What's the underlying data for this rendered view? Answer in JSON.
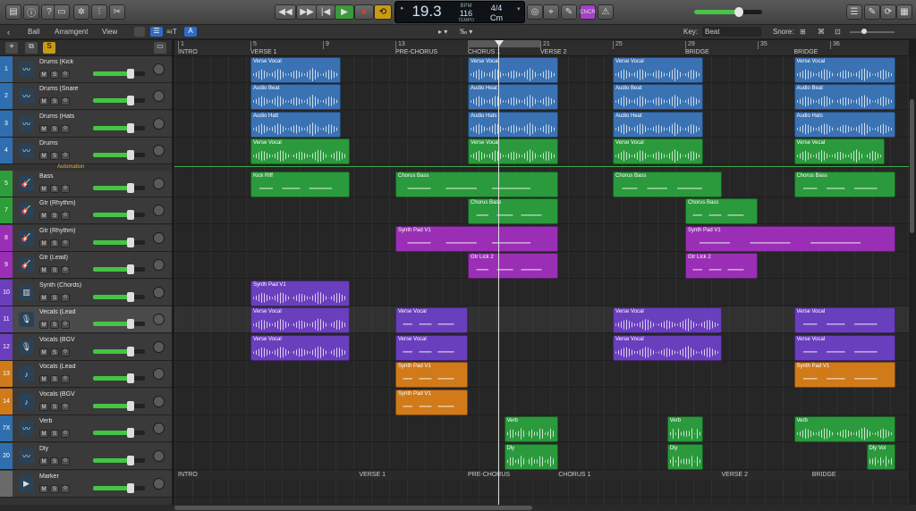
{
  "toolbar": {
    "lcd": {
      "bar": "19.3",
      "bpm": "116",
      "bpm_label": "BPM",
      "keep_label": "KEEP",
      "tempo_label": "TEMPO",
      "sig": "4/4",
      "key": "Cm"
    },
    "smart_badge": "CNCR"
  },
  "subbar": {
    "ball": "Ball",
    "arrangement": "Arramgent",
    "view": "View",
    "key_label": "Key:",
    "key_value": "Beat",
    "snap_label": "Snore:"
  },
  "ruler": {
    "bars": [
      "1",
      "5",
      "9",
      "13",
      "17",
      "21",
      "25",
      "29",
      "35",
      "36"
    ]
  },
  "sections": [
    "INTRO",
    "VERSE 1",
    "PRE-CHORUS",
    "CHORUS 1",
    "VERSE 2",
    "BRIDGE",
    "BRIDGE"
  ],
  "bottom_markers": [
    "INTRO",
    "VERSE 1",
    "PRE-CHORUS",
    "CHORUS 1",
    "VERSE 2",
    "BRIDGE"
  ],
  "automation_label": "Automation",
  "tracks": [
    {
      "num": "1",
      "name": "Drums (Kick",
      "color": "#2f6fb0",
      "icon": "waveform-icon"
    },
    {
      "num": "2",
      "name": "Drums (Snare",
      "color": "#2f6fb0",
      "icon": "waveform-icon"
    },
    {
      "num": "3",
      "name": "Drums (Hats",
      "color": "#2f6fb0",
      "icon": "waveform-icon"
    },
    {
      "num": "4",
      "name": "Drums",
      "color": "#2f6fb0",
      "icon": "waveform-icon"
    },
    {
      "num": "5",
      "name": "Bass",
      "color": "#2e9e3a",
      "icon": "guitar-icon"
    },
    {
      "num": "7",
      "name": "Gtr (Rhythm)",
      "color": "#2e9e3a",
      "icon": "guitar-icon"
    },
    {
      "num": "8",
      "name": "Gtr (Rhythm)",
      "color": "#9a2fb5",
      "icon": "guitar-icon"
    },
    {
      "num": "9",
      "name": "Gtr (Lead)",
      "color": "#9a2fb5",
      "icon": "guitar-icon"
    },
    {
      "num": "10",
      "name": "Synth (Chords)",
      "color": "#6a3fbd",
      "icon": "synth-icon"
    },
    {
      "num": "11",
      "name": "Vecals (Lead",
      "color": "#6a3fbd",
      "icon": "mic-icon"
    },
    {
      "num": "12",
      "name": "Vocals (BGV",
      "color": "#6a3fbd",
      "icon": "mic-icon"
    },
    {
      "num": "13",
      "name": "Vocals (Lead",
      "color": "#d07a1a",
      "icon": "note-icon"
    },
    {
      "num": "14",
      "name": "Vocals (BGV",
      "color": "#d07a1a",
      "icon": "note-icon"
    },
    {
      "num": "7X",
      "name": "Verb",
      "color": "#2f6fb0",
      "icon": "waveform-icon"
    },
    {
      "num": "20",
      "name": "Dly",
      "color": "#2f6fb0",
      "icon": "waveform-icon"
    },
    {
      "num": "",
      "name": "Marker",
      "color": "#6a6a6a",
      "icon": "play-icon"
    }
  ],
  "regions": [
    {
      "lane": 0,
      "name": "Verse Vocal",
      "color": "#3b72b3",
      "kind": "wave",
      "start": 5,
      "end": 10
    },
    {
      "lane": 0,
      "name": "Verse Vocal",
      "color": "#3b72b3",
      "kind": "wave",
      "start": 17,
      "end": 22
    },
    {
      "lane": 0,
      "name": "Verse Vocal",
      "color": "#3b72b3",
      "kind": "wave",
      "start": 25,
      "end": 30
    },
    {
      "lane": 0,
      "name": "Verse Vocal",
      "color": "#3b72b3",
      "kind": "wave",
      "start": 35,
      "end": 40.6
    },
    {
      "lane": 1,
      "name": "Audio Beat",
      "color": "#3b72b3",
      "kind": "wave",
      "start": 5,
      "end": 10
    },
    {
      "lane": 1,
      "name": "Audio Heat",
      "color": "#3b72b3",
      "kind": "wave",
      "start": 17,
      "end": 22
    },
    {
      "lane": 1,
      "name": "Audio Beat",
      "color": "#3b72b3",
      "kind": "wave",
      "start": 25,
      "end": 30
    },
    {
      "lane": 1,
      "name": "Audio Beat",
      "color": "#3b72b3",
      "kind": "wave",
      "start": 35,
      "end": 40.6
    },
    {
      "lane": 2,
      "name": "Audio Hatt",
      "color": "#3b72b3",
      "kind": "wave",
      "start": 5,
      "end": 10
    },
    {
      "lane": 2,
      "name": "Audio Hats",
      "color": "#3b72b3",
      "kind": "wave",
      "start": 17,
      "end": 22
    },
    {
      "lane": 2,
      "name": "Audio Heat",
      "color": "#3b72b3",
      "kind": "wave",
      "start": 25,
      "end": 30
    },
    {
      "lane": 2,
      "name": "Audio Hats",
      "color": "#3b72b3",
      "kind": "wave",
      "start": 35,
      "end": 40.6
    },
    {
      "lane": 3,
      "name": "Verse Vocal",
      "color": "#2a9a3c",
      "kind": "wave",
      "start": 5,
      "end": 10.5
    },
    {
      "lane": 3,
      "name": "Verse Vocal",
      "color": "#2a9a3c",
      "kind": "wave",
      "start": 17,
      "end": 22
    },
    {
      "lane": 3,
      "name": "Verse Vocal",
      "color": "#2a9a3c",
      "kind": "wave",
      "start": 25,
      "end": 30
    },
    {
      "lane": 3,
      "name": "Verse Vecal",
      "color": "#2a9a3c",
      "kind": "wave",
      "start": 35,
      "end": 40
    },
    {
      "lane": 4,
      "name": "Kick Riff",
      "color": "#2a9a3c",
      "kind": "midi",
      "start": 5,
      "end": 10.5
    },
    {
      "lane": 4,
      "name": "Chorus Bass",
      "color": "#2a9a3c",
      "kind": "midi",
      "start": 13,
      "end": 22
    },
    {
      "lane": 4,
      "name": "Chorus Bass",
      "color": "#2a9a3c",
      "kind": "midi",
      "start": 25,
      "end": 31
    },
    {
      "lane": 4,
      "name": "Chorus Bass",
      "color": "#2a9a3c",
      "kind": "midi",
      "start": 35,
      "end": 40.6
    },
    {
      "lane": 5,
      "name": "Chorus Bass",
      "color": "#2a9a3c",
      "kind": "midi",
      "start": 17,
      "end": 22
    },
    {
      "lane": 5,
      "name": "Chorus Bass",
      "color": "#2a9a3c",
      "kind": "midi",
      "start": 29,
      "end": 33
    },
    {
      "lane": 6,
      "name": "Synth Pad V1",
      "color": "#9a2fb5",
      "kind": "midi",
      "start": 13,
      "end": 22
    },
    {
      "lane": 6,
      "name": "Synth Pad V1",
      "color": "#9a2fb5",
      "kind": "midi",
      "start": 29,
      "end": 40.6
    },
    {
      "lane": 7,
      "name": "Gtr Lick 2",
      "color": "#9a2fb5",
      "kind": "midi",
      "start": 17,
      "end": 22
    },
    {
      "lane": 7,
      "name": "Gtr Lick 2",
      "color": "#9a2fb5",
      "kind": "midi",
      "start": 29,
      "end": 33
    },
    {
      "lane": 8,
      "name": "Synth Pad V1",
      "color": "#6a3fbd",
      "kind": "wave",
      "start": 5,
      "end": 10.5
    },
    {
      "lane": 9,
      "name": "Verse Vocal",
      "color": "#6a3fbd",
      "kind": "wave",
      "start": 5,
      "end": 10.5
    },
    {
      "lane": 9,
      "name": "Verse Vocal",
      "color": "#6a3fbd",
      "kind": "midi",
      "start": 13,
      "end": 17
    },
    {
      "lane": 9,
      "name": "Verse Vocal",
      "color": "#6a3fbd",
      "kind": "wave",
      "start": 25,
      "end": 31
    },
    {
      "lane": 9,
      "name": "Verse Vocal",
      "color": "#6a3fbd",
      "kind": "midi",
      "start": 35,
      "end": 40.6
    },
    {
      "lane": 10,
      "name": "Verse Vocal",
      "color": "#6a3fbd",
      "kind": "wave",
      "start": 5,
      "end": 10.5
    },
    {
      "lane": 10,
      "name": "Verse Vocal",
      "color": "#6a3fbd",
      "kind": "midi",
      "start": 13,
      "end": 17
    },
    {
      "lane": 10,
      "name": "Verse Vocal",
      "color": "#6a3fbd",
      "kind": "wave",
      "start": 25,
      "end": 31
    },
    {
      "lane": 10,
      "name": "Verse Vocal",
      "color": "#6a3fbd",
      "kind": "midi",
      "start": 35,
      "end": 40.6
    },
    {
      "lane": 11,
      "name": "Synth Pad V1",
      "color": "#d07a1a",
      "kind": "midi",
      "start": 13,
      "end": 17
    },
    {
      "lane": 11,
      "name": "Synth Pad V1",
      "color": "#d07a1a",
      "kind": "midi",
      "start": 35,
      "end": 40.6
    },
    {
      "lane": 12,
      "name": "Synth Pad V1",
      "color": "#d07a1a",
      "kind": "midi",
      "start": 13,
      "end": 17
    },
    {
      "lane": 13,
      "name": "Verb",
      "color": "#2a9a3c",
      "kind": "wave",
      "start": 19,
      "end": 22
    },
    {
      "lane": 13,
      "name": "Verb",
      "color": "#2a9a3c",
      "kind": "wave",
      "start": 28,
      "end": 30
    },
    {
      "lane": 13,
      "name": "Verb",
      "color": "#2a9a3c",
      "kind": "wave",
      "start": 35,
      "end": 40.6
    },
    {
      "lane": 14,
      "name": "Dly",
      "color": "#2a9a3c",
      "kind": "wave",
      "start": 19,
      "end": 22
    },
    {
      "lane": 14,
      "name": "Dly",
      "color": "#2a9a3c",
      "kind": "wave",
      "start": 28,
      "end": 30
    },
    {
      "lane": 14,
      "name": "Dly Vol",
      "color": "#2a9a3c",
      "kind": "wave",
      "start": 39,
      "end": 40.6
    }
  ]
}
